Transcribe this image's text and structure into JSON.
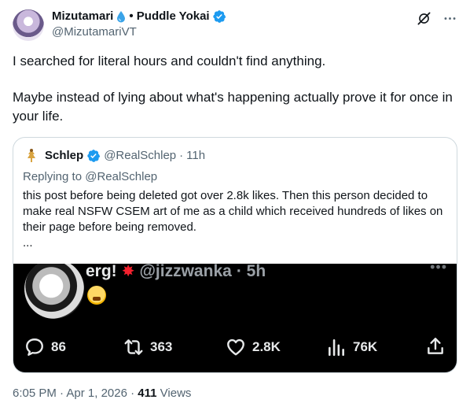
{
  "author": {
    "display_name": "Mizutamari",
    "name_suffix": "• Puddle Yokai",
    "handle": "@MizutamariVT",
    "verified": true
  },
  "post": {
    "paragraphs": [
      "I searched for literal hours and couldn't find anything.",
      "Maybe instead of lying about what's happening actually prove it for once in your life."
    ]
  },
  "quote": {
    "name": "Schlep",
    "handle": "@RealSchlep",
    "separator": "·",
    "time": "11h",
    "replying_to": "Replying to @RealSchlep",
    "body": "this post before being deleted got over 2.8k likes. Then this person decided to make real NSFW CSEM art of me as a child which received hundreds of likes on their page before being removed.",
    "ellipsis": "...",
    "image": {
      "name_text": "erg!",
      "handle_text": "@jizzwanka",
      "time_text": "· 5h",
      "more": "•••",
      "replies": "86",
      "reposts": "363",
      "likes": "2.8K",
      "views": "76K"
    }
  },
  "footer": {
    "time": "6:05 PM",
    "separator": "·",
    "date": "Apr 1, 2026",
    "dot": "·",
    "views_count": "411",
    "views_label": "Views"
  },
  "colors": {
    "verified_blue": "#1d9bf0",
    "secondary_text": "#536471",
    "border": "#cfd9de"
  }
}
